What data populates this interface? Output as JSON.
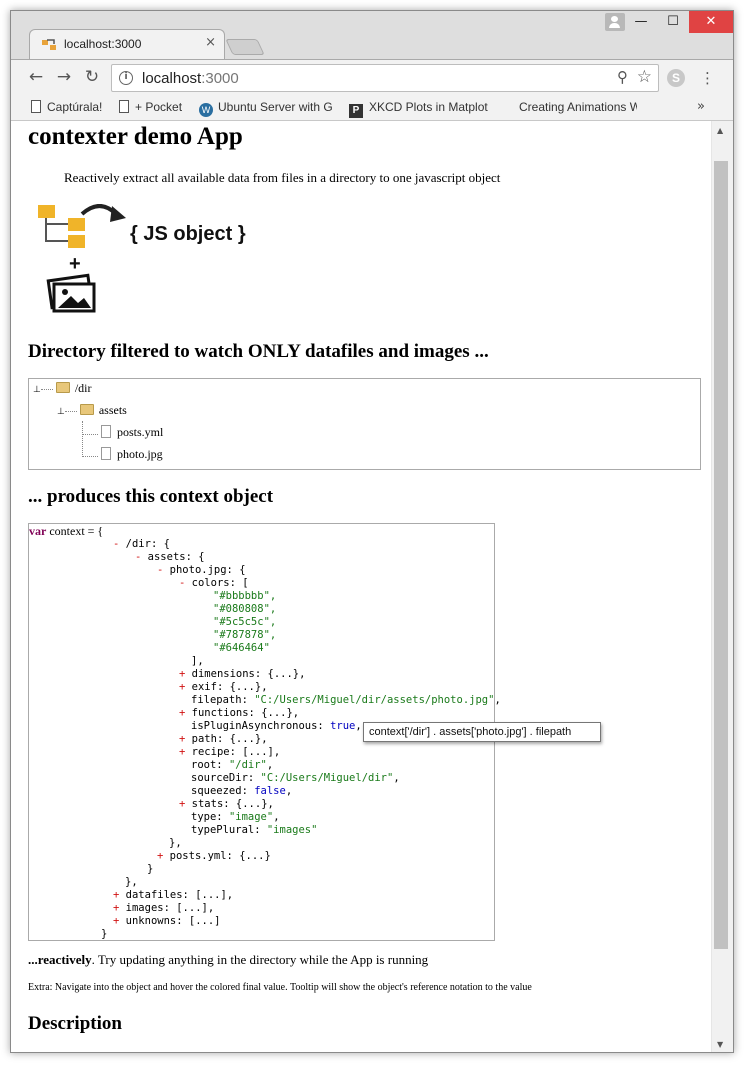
{
  "browser": {
    "tab_title": "localhost:3000",
    "tab_close": "×",
    "url_host": "localhost",
    "url_port": ":3000",
    "bookmarks": [
      "Captúrala!",
      "+ Pocket",
      "Ubuntu Server with G",
      "XKCD Plots in Matplot",
      "Creating Animations W"
    ],
    "bookmarks_more": "»",
    "window_buttons": {
      "minimize": "—",
      "maximize": "☐",
      "close": "✕"
    }
  },
  "page": {
    "title": "contexter demo App",
    "subtitle": "Reactively extract all available data from files in a directory to one javascript object",
    "logo_text": "{ JS object }",
    "logo_plus": "+",
    "heading_dir": "Directory filtered to watch ONLY datafiles and images ...",
    "heading_produces": "... produces this context object",
    "heading_description": "Description",
    "tree": [
      "/dir",
      "assets",
      "posts.yml",
      "photo.jpg"
    ],
    "reactively_bold": "...reactively",
    "reactively_rest": ". Try updating anything in the directory while the App is running",
    "extra": "Extra: Navigate into the object and hover the colored final value. Tooltip will show the object's reference notation to the value",
    "tooltip": "context['/dir'] . assets['photo.jpg'] . filepath"
  },
  "code": {
    "var_kw": "var",
    "var_rest": " context = {",
    "lines": {
      "l1_tog": "- ",
      "l1": "/dir: {",
      "l2_tog": "- ",
      "l2": "assets: {",
      "l3_tog": "- ",
      "l3": "photo.jpg: {",
      "l4_tog": "- ",
      "l4": "colors: [",
      "c1": "\"#bbbbbb\",",
      "c2": "\"#080808\",",
      "c3": "\"#5c5c5c\",",
      "c4": "\"#787878\",",
      "c5": "\"#646464\"",
      "l5": "],",
      "l6_tog": "+ ",
      "l6": "dimensions: {...},",
      "l7_tog": "+ ",
      "l7": "exif: {...},",
      "l8_key": "filepath: ",
      "l8_val": "\"C:/Users/Miguel/dir/assets/photo.jpg\"",
      "l8_end": ",",
      "l9_tog": "+ ",
      "l9": "functions: {...},",
      "l10_key": "isPluginAsynchronous: ",
      "l10_val": "true",
      "l10_end": ",",
      "l11_tog": "+ ",
      "l11": "path: {...},",
      "l12_tog": "+ ",
      "l12": "recipe: [...],",
      "l13_key": "root: ",
      "l13_val": "\"/dir\"",
      "l13_end": ",",
      "l14_key": "sourceDir: ",
      "l14_val": "\"C:/Users/Miguel/dir\"",
      "l14_end": ",",
      "l15_key": "squeezed: ",
      "l15_val": "false",
      "l15_end": ",",
      "l16_tog": "+ ",
      "l16": "stats: {...},",
      "l17_key": "type: ",
      "l17_val": "\"image\"",
      "l17_end": ",",
      "l18_key": "typePlural: ",
      "l18_val": "\"images\"",
      "l19": "},",
      "l20_tog": "+ ",
      "l20": "posts.yml: {...}",
      "l21": "}",
      "l22": "},",
      "l23_tog": "+ ",
      "l23": "datafiles: [...],",
      "l24_tog": "+ ",
      "l24": "images: [...],",
      "l25_tog": "+ ",
      "l25": "unknowns: [...]",
      "l26": "}"
    }
  }
}
